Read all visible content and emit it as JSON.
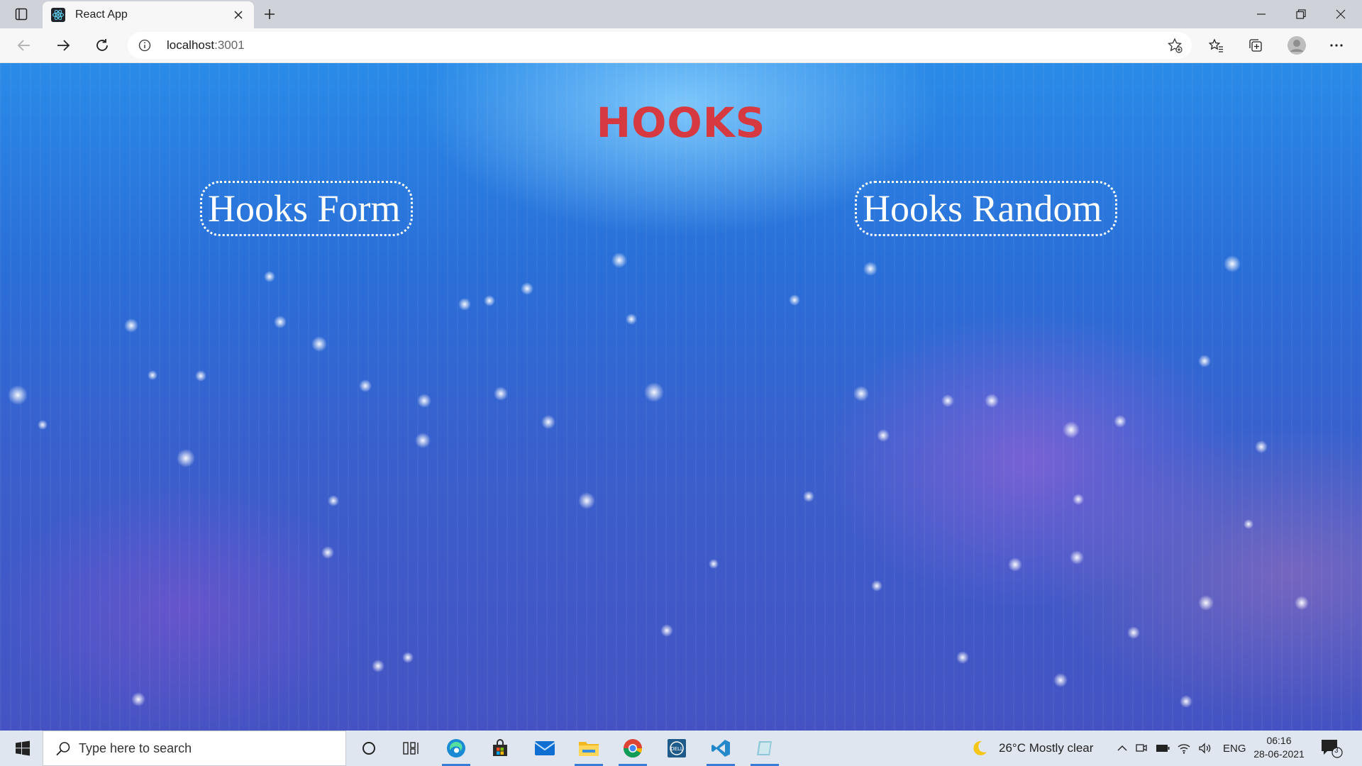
{
  "browser": {
    "tab_title": "React App",
    "address_host": "localhost",
    "address_port": ":3001"
  },
  "page": {
    "title": "HOOKS",
    "links": [
      {
        "label": "Hooks Form"
      },
      {
        "label": "Hooks Random"
      }
    ],
    "colors": {
      "title": "#d6393f",
      "link_text": "#ffffff"
    }
  },
  "taskbar": {
    "search_placeholder": "Type here to search",
    "weather": "26°C  Mostly clear",
    "language": "ENG",
    "time": "06:16",
    "date": "28-06-2021",
    "notification_count": "3"
  }
}
